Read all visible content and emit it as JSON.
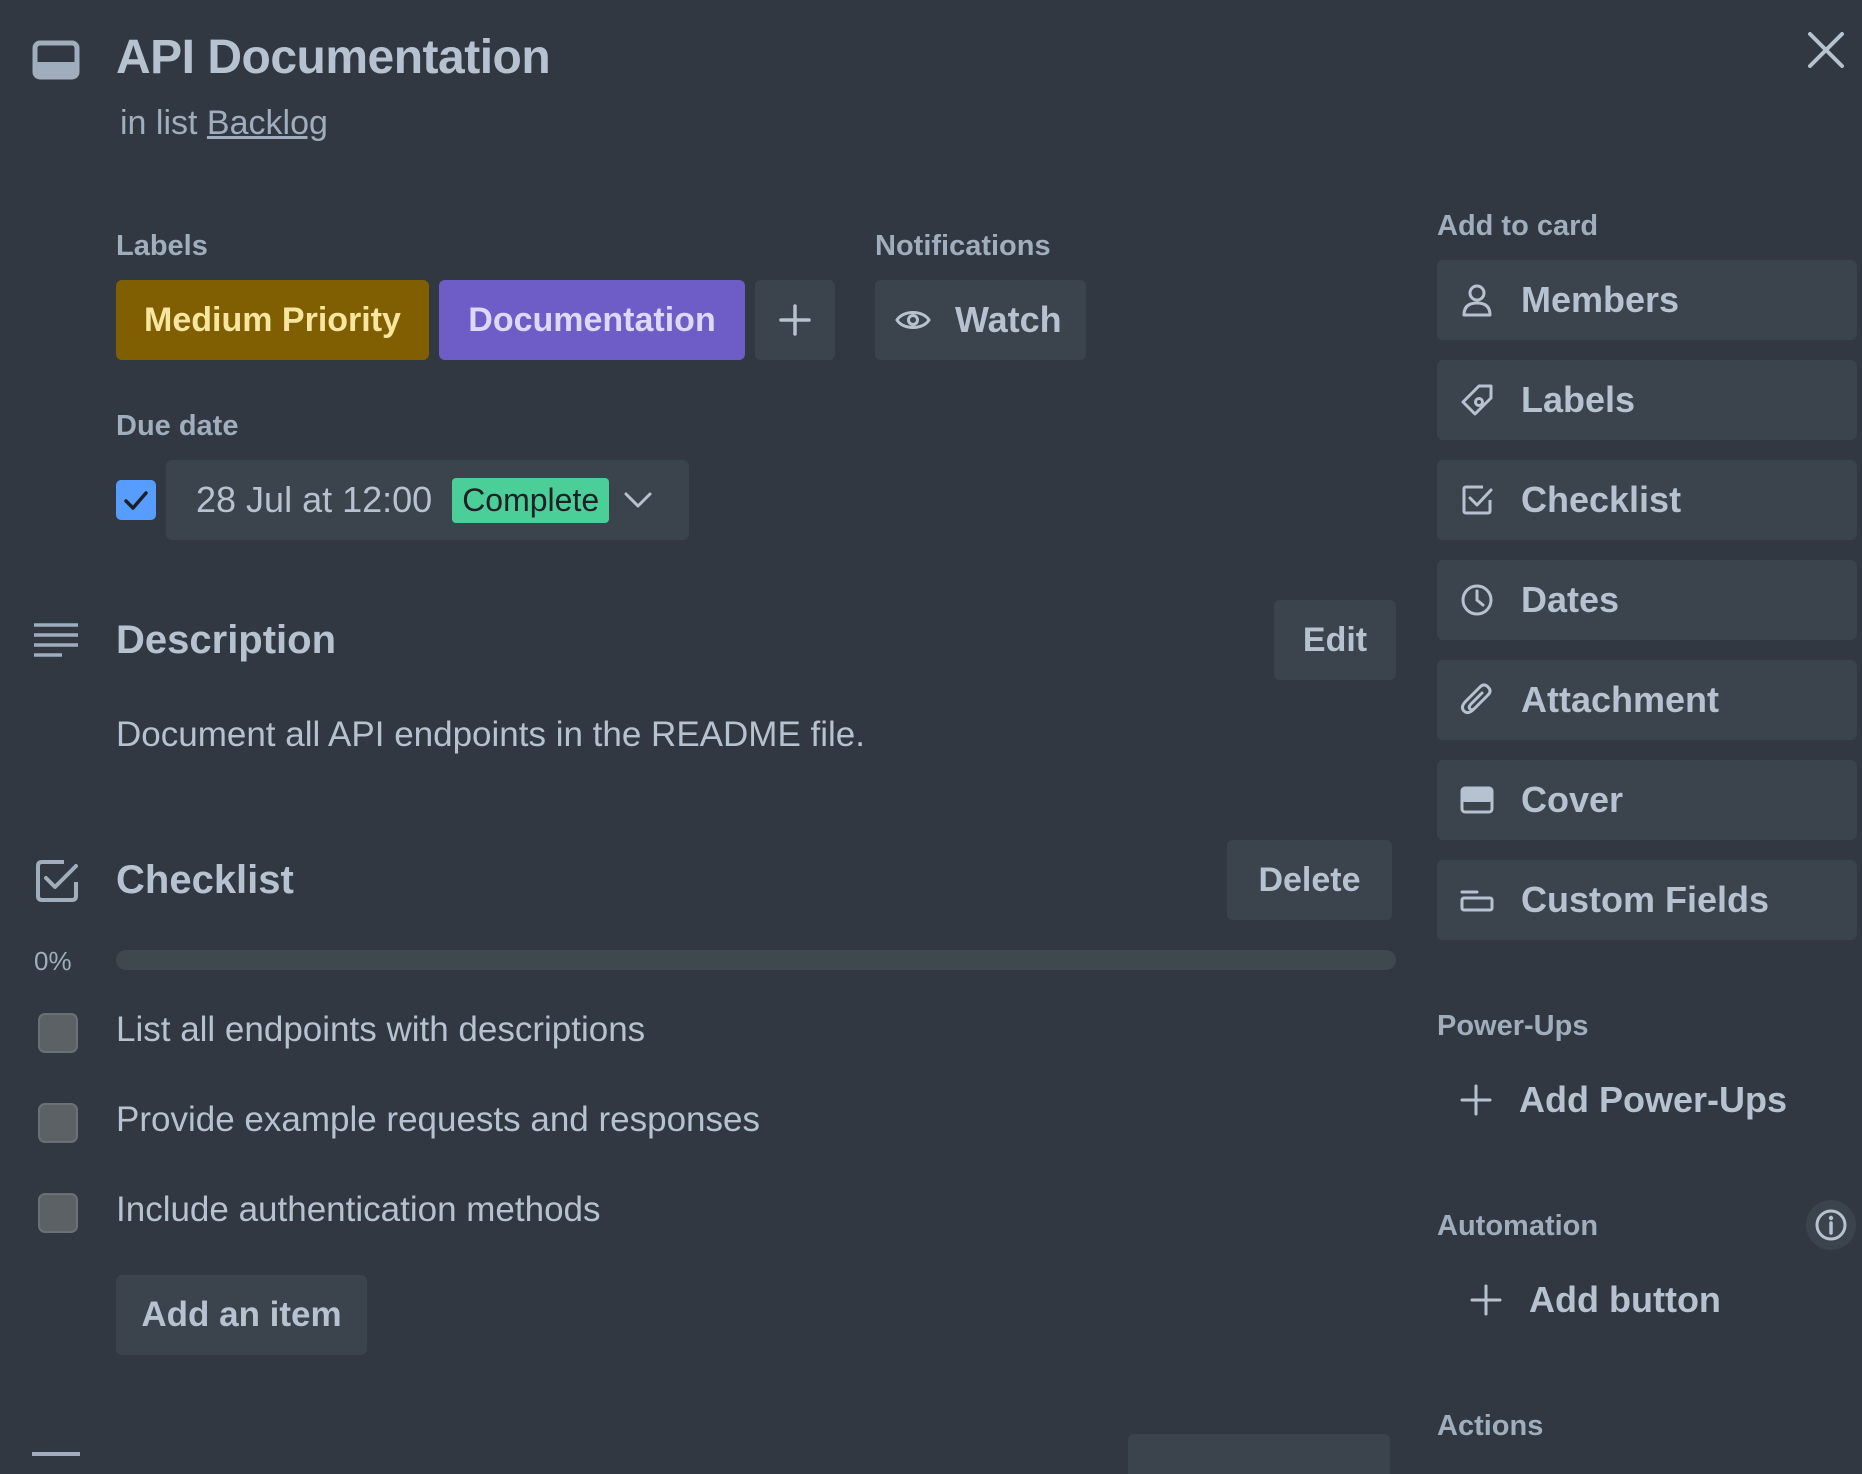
{
  "card": {
    "title": "API Documentation",
    "list_prefix": "in list",
    "list_name": "Backlog",
    "icon": "card-icon"
  },
  "close": {
    "icon": "close-icon"
  },
  "labels": {
    "heading": "Labels",
    "items": [
      {
        "text": "Medium Priority",
        "bg": "#7f5f01",
        "fg": "#f8e6a0"
      },
      {
        "text": "Documentation",
        "bg": "#6e5dc6",
        "fg": "#dfd8fd"
      }
    ],
    "add_icon": "plus-icon"
  },
  "notifications": {
    "heading": "Notifications",
    "watch_label": "Watch",
    "watch_icon": "eye-icon"
  },
  "due_date": {
    "heading": "Due date",
    "checked": true,
    "value": "28 Jul at 12:00",
    "status": "Complete",
    "status_bg": "#4bce97",
    "status_fg": "#1d2125",
    "dropdown_icon": "chevron-down-icon"
  },
  "description": {
    "heading": "Description",
    "edit_label": "Edit",
    "text": "Document all API endpoints in the README file.",
    "icon": "description-lines-icon"
  },
  "checklist": {
    "heading": "Checklist",
    "delete_label": "Delete",
    "progress_text": "0%",
    "progress": 0,
    "items": [
      {
        "text": "List all endpoints with descriptions",
        "done": false
      },
      {
        "text": "Provide example requests and responses",
        "done": false
      },
      {
        "text": "Include authentication methods",
        "done": false
      }
    ],
    "add_item_label": "Add an item",
    "icon": "checklist-icon"
  },
  "sidebar": {
    "add_to_card_heading": "Add to card",
    "add_to_card": [
      {
        "label": "Members",
        "icon": "person-icon"
      },
      {
        "label": "Labels",
        "icon": "tag-icon"
      },
      {
        "label": "Checklist",
        "icon": "checkbox-icon"
      },
      {
        "label": "Dates",
        "icon": "clock-icon"
      },
      {
        "label": "Attachment",
        "icon": "paperclip-icon"
      },
      {
        "label": "Cover",
        "icon": "cover-icon"
      },
      {
        "label": "Custom Fields",
        "icon": "custom-fields-icon"
      }
    ],
    "powerups_heading": "Power-Ups",
    "add_powerups_label": "Add Power-Ups",
    "automation_heading": "Automation",
    "automation_info_icon": "info-icon",
    "add_button_label": "Add button",
    "actions_heading": "Actions"
  },
  "colors": {
    "background": "#323841",
    "button": "#3b434c",
    "text": "#b6c2cf",
    "muted": "#9fadbc",
    "checkbox_checked": "#579dff"
  }
}
